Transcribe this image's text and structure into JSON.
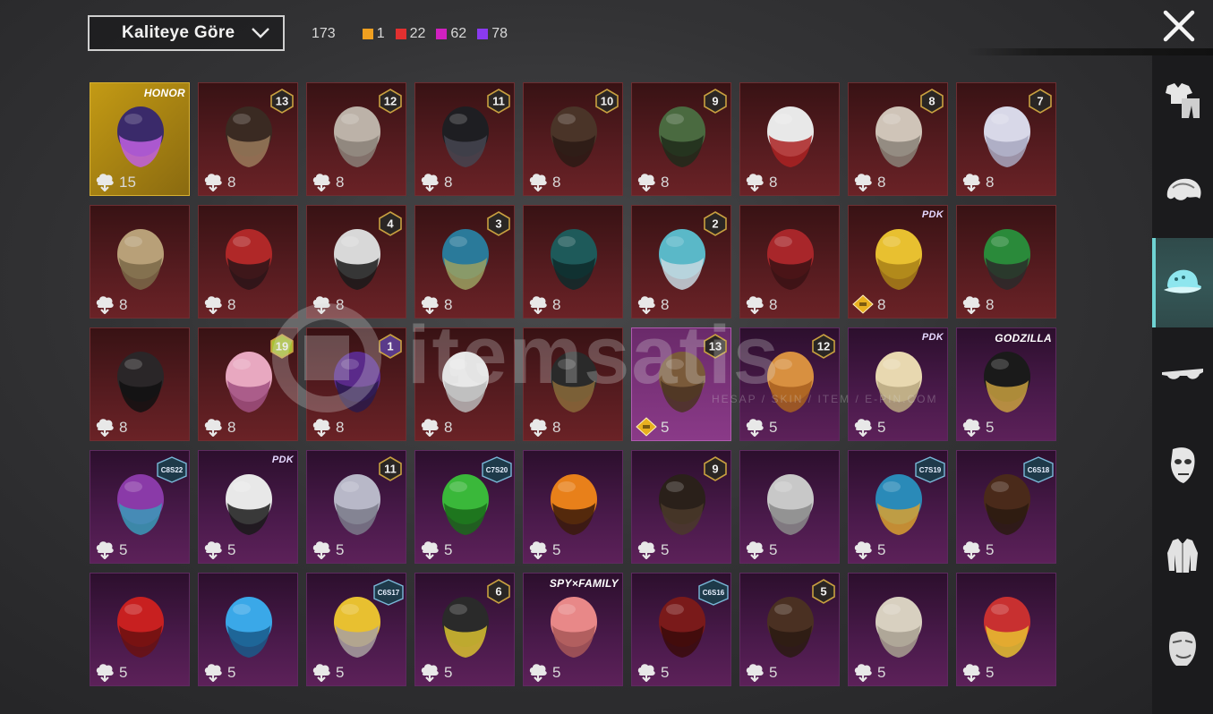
{
  "sort": {
    "label": "Kaliteye Göre"
  },
  "counts": {
    "total": "173",
    "by_quality": [
      {
        "color": "#f0a020",
        "value": "1"
      },
      {
        "color": "#e23030",
        "value": "22"
      },
      {
        "color": "#d020c0",
        "value": "62"
      },
      {
        "color": "#8a3af0",
        "value": "78"
      }
    ]
  },
  "watermark": {
    "brand": "itemsatis",
    "tagline": "HESAP / SKIN / ITEM / E-PIN.COM"
  },
  "sidebar": {
    "items": [
      {
        "name": "outfit-category",
        "icon": "outfit-icon",
        "active": false
      },
      {
        "name": "hair-category",
        "icon": "hair-icon",
        "active": false
      },
      {
        "name": "hat-category",
        "icon": "hat-icon",
        "active": true
      },
      {
        "name": "glasses-category",
        "icon": "glasses-icon",
        "active": false
      },
      {
        "name": "mask-category",
        "icon": "mask-icon",
        "active": false
      },
      {
        "name": "top-category",
        "icon": "jacket-icon",
        "active": false
      },
      {
        "name": "face-category",
        "icon": "face-icon",
        "active": false
      }
    ]
  },
  "items": [
    {
      "rarity": "gold",
      "qty": "15",
      "brand": "HONOR",
      "art": "avatar-figure"
    },
    {
      "rarity": "red",
      "qty": "8",
      "level": "13",
      "art": "hat-brim"
    },
    {
      "rarity": "red",
      "qty": "8",
      "level": "12",
      "art": "hair-curly"
    },
    {
      "rarity": "red",
      "qty": "8",
      "level": "11",
      "art": "helmet-black"
    },
    {
      "rarity": "red",
      "qty": "8",
      "level": "10",
      "art": "hair-long"
    },
    {
      "rarity": "red",
      "qty": "8",
      "level": "9",
      "art": "zombie-head"
    },
    {
      "rarity": "red",
      "qty": "8",
      "art": "cowboy-hat"
    },
    {
      "rarity": "red",
      "qty": "8",
      "level": "8",
      "art": "hair-winged"
    },
    {
      "rarity": "red",
      "qty": "8",
      "level": "7",
      "art": "hair-white"
    },
    {
      "rarity": "red",
      "qty": "8",
      "art": "hair-blonde"
    },
    {
      "rarity": "red",
      "qty": "8",
      "art": "helmet-red"
    },
    {
      "rarity": "red",
      "qty": "8",
      "level": "4",
      "art": "snowman-hat"
    },
    {
      "rarity": "red",
      "qty": "8",
      "level": "3",
      "art": "joker-head"
    },
    {
      "rarity": "red",
      "qty": "8",
      "art": "dragon-helmet"
    },
    {
      "rarity": "red",
      "qty": "8",
      "level": "2",
      "art": "bucket-hat"
    },
    {
      "rarity": "red",
      "qty": "8",
      "art": "knight-helmet"
    },
    {
      "rarity": "red",
      "qty": "8",
      "brand": "PDK",
      "premium": true,
      "art": "hair-gold"
    },
    {
      "rarity": "red",
      "qty": "8",
      "art": "green-helmet"
    },
    {
      "rarity": "red",
      "qty": "8",
      "art": "bunny-helmet"
    },
    {
      "rarity": "red",
      "qty": "8",
      "level": "19",
      "art": "pink-mask"
    },
    {
      "rarity": "red",
      "qty": "8",
      "level": "1",
      "art": "purple-helmet"
    },
    {
      "rarity": "red",
      "qty": "8",
      "art": "ghost-hood"
    },
    {
      "rarity": "red",
      "qty": "8",
      "art": "tricorn-hat"
    },
    {
      "rarity": "selected",
      "qty": "5",
      "level": "13",
      "premium": true,
      "art": "aviator-cap"
    },
    {
      "rarity": "purple",
      "qty": "5",
      "level": "12",
      "art": "hair-pigtails"
    },
    {
      "rarity": "purple",
      "qty": "5",
      "brand": "PDK",
      "art": "hair-bob"
    },
    {
      "rarity": "purple",
      "qty": "5",
      "brand": "GODZILLA",
      "art": "spiked-cap"
    },
    {
      "rarity": "purple",
      "qty": "5",
      "season": "C8S22",
      "art": "hair-rainbow"
    },
    {
      "rarity": "purple",
      "qty": "5",
      "brand": "PDK",
      "art": "panda-head"
    },
    {
      "rarity": "purple",
      "qty": "5",
      "level": "11",
      "art": "hair-flower"
    },
    {
      "rarity": "purple",
      "qty": "5",
      "season": "C7S20",
      "art": "hair-green"
    },
    {
      "rarity": "purple",
      "qty": "5",
      "art": "pumpkin-head"
    },
    {
      "rarity": "purple",
      "qty": "5",
      "level": "9",
      "art": "hair-dark"
    },
    {
      "rarity": "purple",
      "qty": "5",
      "art": "hair-grey"
    },
    {
      "rarity": "purple",
      "qty": "5",
      "season": "C7S19",
      "art": "feather-headdress"
    },
    {
      "rarity": "purple",
      "qty": "5",
      "season": "C6S18",
      "art": "hair-brown"
    },
    {
      "rarity": "purple",
      "qty": "5",
      "art": "hair-red"
    },
    {
      "rarity": "purple",
      "qty": "5",
      "art": "blue-cap"
    },
    {
      "rarity": "purple",
      "qty": "5",
      "season": "C6S17",
      "art": "visor-cap"
    },
    {
      "rarity": "purple",
      "qty": "5",
      "level": "6",
      "art": "samurai-helmet"
    },
    {
      "rarity": "purple",
      "qty": "5",
      "brand": "SPY×FAMILY",
      "art": "hair-pink"
    },
    {
      "rarity": "purple",
      "qty": "5",
      "season": "C6S16",
      "art": "hair-crimson"
    },
    {
      "rarity": "purple",
      "qty": "5",
      "level": "5",
      "art": "hair-bows"
    },
    {
      "rarity": "purple",
      "qty": "5",
      "art": "hair-braided"
    },
    {
      "rarity": "purple",
      "qty": "5",
      "art": "demon-mask"
    }
  ]
}
